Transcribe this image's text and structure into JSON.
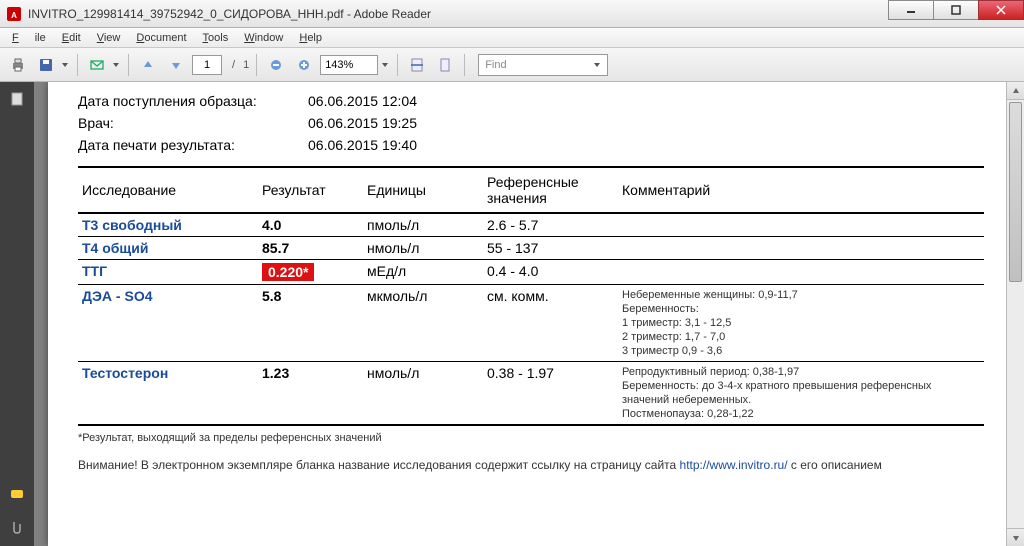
{
  "window": {
    "title": "INVITRO_129981414_39752942_0_СИДОРОВА_ННН.pdf - Adobe Reader"
  },
  "menu": {
    "file": "File",
    "edit": "Edit",
    "view": "View",
    "document": "Document",
    "tools": "Tools",
    "window": "Window",
    "help": "Help"
  },
  "toolbar": {
    "page_current": "1",
    "page_sep": "/",
    "page_total": "1",
    "zoom": "143%",
    "find_placeholder": "Find"
  },
  "doc": {
    "meta": [
      {
        "label": "Дата поступления образца:",
        "value": "06.06.2015 12:04"
      },
      {
        "label": "Врач:",
        "value": "06.06.2015 19:25"
      },
      {
        "label": "Дата печати результата:",
        "value": "06.06.2015 19:40"
      }
    ],
    "headers": {
      "test": "Исследование",
      "result": "Результат",
      "units": "Единицы",
      "reference": "Референсные значения",
      "comment": "Комментарий"
    },
    "rows": [
      {
        "test": "Т3 свободный",
        "result": "4.0",
        "flag": false,
        "units": "пмоль/л",
        "reference": "2.6 - 5.7",
        "comment": ""
      },
      {
        "test": "Т4 общий",
        "result": "85.7",
        "flag": false,
        "units": "нмоль/л",
        "reference": "55 - 137",
        "comment": ""
      },
      {
        "test": "ТТГ",
        "result": "0.220*",
        "flag": true,
        "units": "мЕд/л",
        "reference": "0.4 - 4.0",
        "comment": ""
      },
      {
        "test": "ДЭА - SO4",
        "result": "5.8",
        "flag": false,
        "units": "мкмоль/л",
        "reference": "см. комм.",
        "comment": "Небеременные женщины: 0,9-11,7\nБеременность:\n1 триместр: 3,1 - 12,5\n2 триместр: 1,7 - 7,0\n3 триместр 0,9 - 3,6"
      },
      {
        "test": "Тестостерон",
        "result": "1.23",
        "flag": false,
        "units": "нмоль/л",
        "reference": "0.38 - 1.97",
        "comment": "Репродуктивный период: 0,38-1,97\nБеременность: до 3-4-х кратного превышения референсных значений небеременных.\nПостменопауза: 0,28-1,22"
      }
    ],
    "footnote": "*Результат, выходящий за пределы референсных значений",
    "notice_pre": "Внимание! В электронном экземпляре бланка название исследования содержит ссылку на страницу сайта ",
    "notice_link": "http://www.invitro.ru/",
    "notice_post": " с его описанием"
  }
}
